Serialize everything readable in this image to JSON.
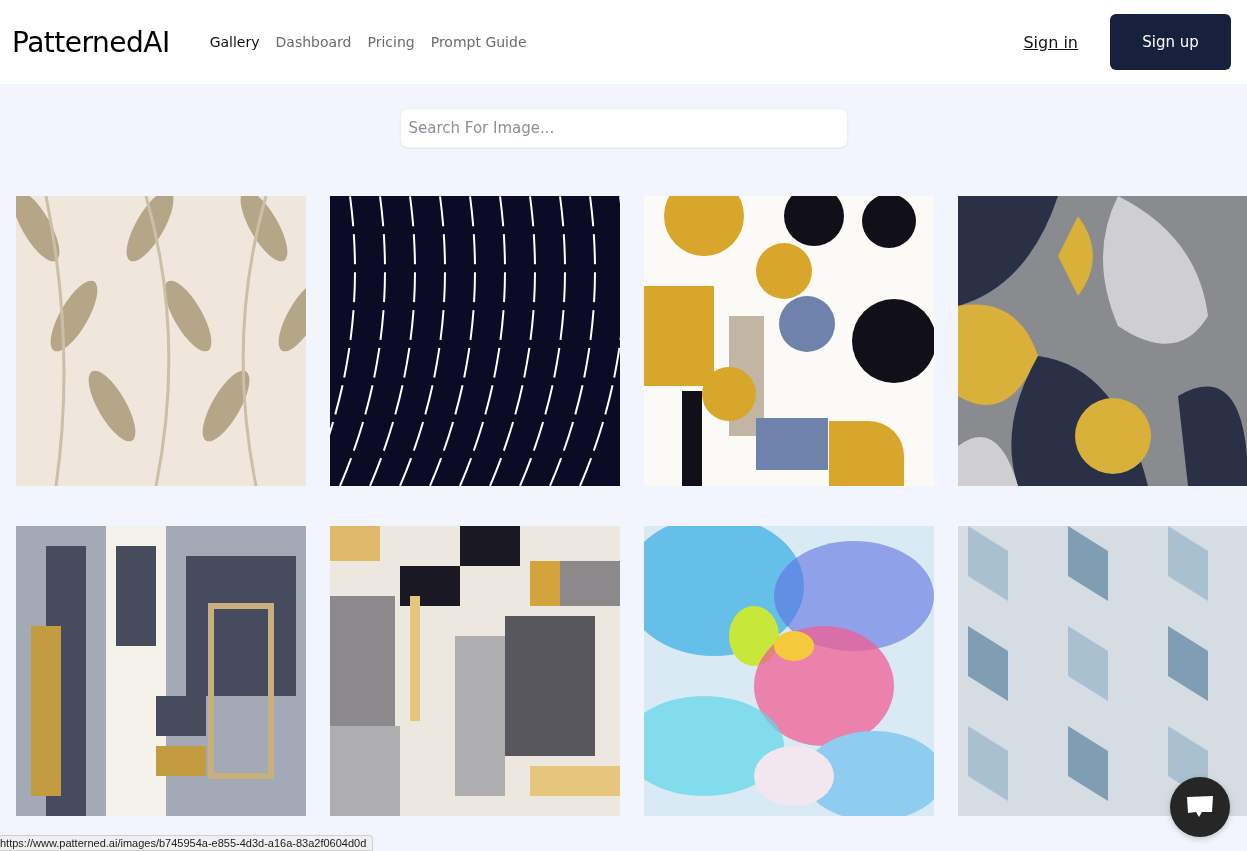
{
  "header": {
    "logo": "PatternedAI",
    "nav": [
      {
        "label": "Gallery",
        "selected": true
      },
      {
        "label": "Dashboard",
        "selected": false
      },
      {
        "label": "Pricing",
        "selected": false
      },
      {
        "label": "Prompt Guide",
        "selected": false
      }
    ],
    "sign_in": "Sign in",
    "sign_up": "Sign up"
  },
  "search": {
    "placeholder": "Search For Image..."
  },
  "status_bar": "https://www.patterned.ai/images/b745954a-e855-4d3d-a16a-83a2f0604d0d"
}
